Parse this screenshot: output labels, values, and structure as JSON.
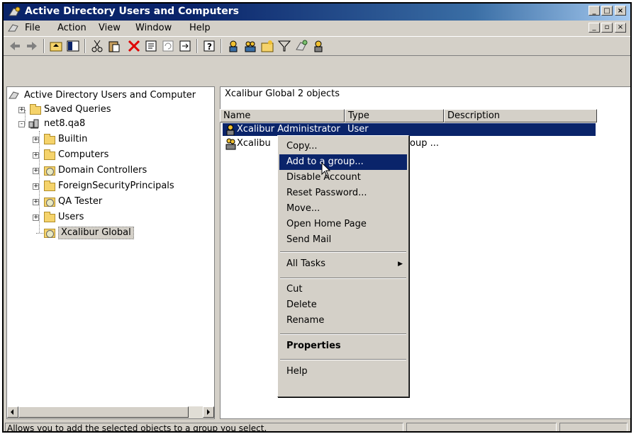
{
  "window": {
    "title": "Active Directory Users and Computers",
    "controls": [
      "_",
      "□",
      "×"
    ]
  },
  "menubar": {
    "items": [
      "File",
      "Action",
      "View",
      "Window",
      "Help"
    ],
    "mdi_controls": [
      "_",
      "▫",
      "×"
    ]
  },
  "tree": {
    "root": "Active Directory Users and Computer",
    "items": [
      {
        "label": "Saved Queries",
        "kind": "folder"
      },
      {
        "label": "net8.qa8",
        "kind": "domain"
      },
      {
        "label": "Builtin",
        "kind": "folder"
      },
      {
        "label": "Computers",
        "kind": "folder"
      },
      {
        "label": "Domain Controllers",
        "kind": "ou"
      },
      {
        "label": "ForeignSecurityPrincipals",
        "kind": "folder"
      },
      {
        "label": "QA Tester",
        "kind": "ou"
      },
      {
        "label": "Users",
        "kind": "folder"
      },
      {
        "label": "Xcalibur Global",
        "kind": "ou"
      }
    ]
  },
  "right": {
    "header": "Xcalibur Global   2 objects",
    "columns": [
      "Name",
      "Type",
      "Description"
    ],
    "rows": [
      {
        "name": "Xcalibur Administrator",
        "type": "User"
      },
      {
        "name": "Xcalibu",
        "type": "oup ..."
      }
    ]
  },
  "context_menu": {
    "items": [
      "Copy...",
      "Add to a group...",
      "Disable Account",
      "Reset Password...",
      "Move...",
      "Open Home Page",
      "Send Mail",
      "All Tasks",
      "Cut",
      "Delete",
      "Rename",
      "Properties",
      "Help"
    ],
    "submenu_arrow": "▶"
  },
  "statusbar": {
    "text": "Allows you to add the selected objects to a group you select."
  },
  "colors": {
    "title_bg": "#0a246a",
    "selection": "#0a246a",
    "face": "#d4d0c8"
  }
}
